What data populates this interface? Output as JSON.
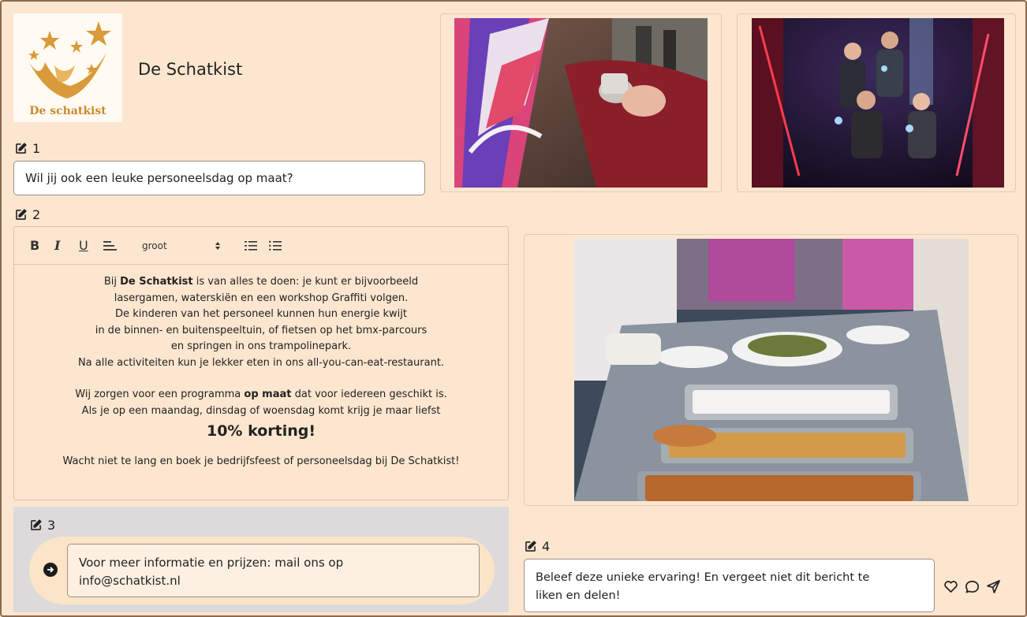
{
  "brand": {
    "logo_text": "De schatkist",
    "title": "De Schatkist"
  },
  "blocks": {
    "b1": {
      "number": "1",
      "value": "Wil jij ook een leuke personeelsdag op maat?"
    },
    "b2": {
      "number": "2"
    },
    "b3": {
      "number": "3",
      "value_line1": "Voor meer informatie en prijzen: mail ons op",
      "value_line2": "info@schatkist.nl"
    },
    "b4": {
      "number": "4",
      "value_line1": "Beleef deze unieke ervaring! En vergeet niet dit bericht te",
      "value_line2": "liken en delen!"
    }
  },
  "toolbar": {
    "bold": "B",
    "italic": "I",
    "underline": "U",
    "size_select": "groot"
  },
  "editor": {
    "p1_pre": "Bij ",
    "p1_bold": "De Schatkist",
    "p1_post": " is van alles te doen: je kunt er bijvoorbeeld",
    "l2": "lasergamen, waterskiën en een workshop Graffiti volgen.",
    "l3": "De kinderen van het personeel kunnen hun energie kwijt",
    "l4": "in de binnen- en buitenspeeltuin, of fietsen op het bmx-parcours",
    "l5": "en springen in ons trampolinepark.",
    "l6": "Na alle activiteiten kun je lekker eten in ons all-you-can-eat-restaurant.",
    "p2_pre": "Wij zorgen voor een programma ",
    "p2_bold": "op maat",
    "p2_post": " dat voor iedereen geschikt is.",
    "l8": "Als je op een maandag, dinsdag of woensdag komt krijg je maar liefst",
    "discount": "10% korting!",
    "l10": "Wacht niet te lang en boek je bedrijfsfeest of personeelsdag bij De Schatkist!"
  },
  "icons": {
    "edit": "edit-icon",
    "arrow": "arrow-right-circle-icon",
    "like": "heart-icon",
    "comment": "comment-icon",
    "share": "send-icon"
  },
  "colors": {
    "background": "#fce6cf",
    "logo_gold": "#d99a3a",
    "section_gray": "#dcdadb"
  }
}
